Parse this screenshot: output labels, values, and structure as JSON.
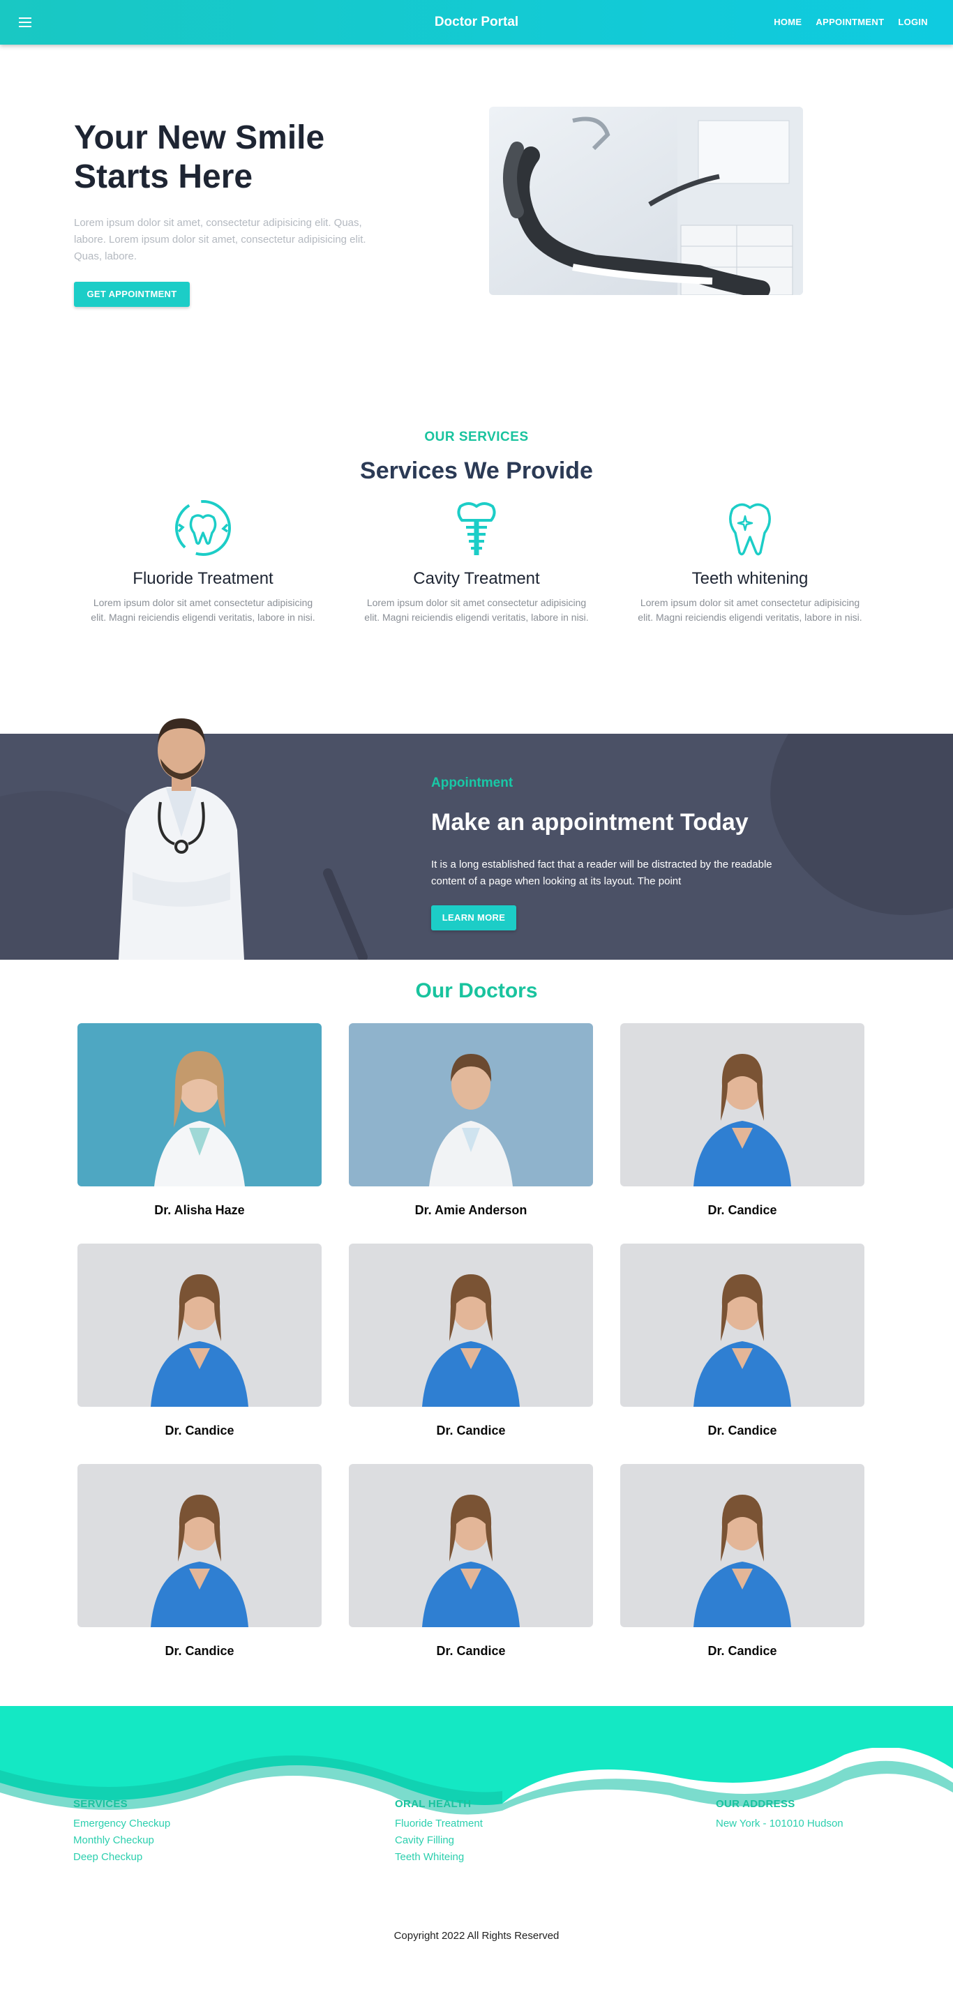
{
  "header": {
    "brand": "Doctor Portal",
    "nav": [
      "HOME",
      "APPOINTMENT",
      "LOGIN"
    ]
  },
  "hero": {
    "title": "Your New Smile Starts Here",
    "text": "Lorem ipsum dolor sit amet, consectetur adipisicing elit. Quas, labore. Lorem ipsum dolor sit amet, consectetur adipisicing elit. Quas, labore.",
    "button": "GET APPOINTMENT"
  },
  "services": {
    "eyebrow": "OUR SERVICES",
    "heading": "Services We Provide",
    "items": [
      {
        "icon": "tooth-cycle-icon",
        "title": "Fluoride Treatment",
        "desc": "Lorem ipsum dolor sit amet consectetur adipisicing elit. Magni reiciendis eligendi veritatis, labore in nisi."
      },
      {
        "icon": "dental-implant-icon",
        "title": "Cavity Treatment",
        "desc": "Lorem ipsum dolor sit amet consectetur adipisicing elit. Magni reiciendis eligendi veritatis, labore in nisi."
      },
      {
        "icon": "sparkling-tooth-icon",
        "title": "Teeth whitening",
        "desc": "Lorem ipsum dolor sit amet consectetur adipisicing elit. Magni reiciendis eligendi veritatis, labore in nisi."
      }
    ]
  },
  "appointment": {
    "eyebrow": "Appointment",
    "title": "Make an appointment Today",
    "text": "It is a long established fact that a reader will be distracted by the readable content of a page when looking at its layout. The point",
    "button": "LEARN MORE"
  },
  "doctors": {
    "heading": "Our Doctors",
    "items": [
      {
        "name": "Dr. Alisha Haze"
      },
      {
        "name": "Dr. Amie Anderson"
      },
      {
        "name": "Dr. Candice"
      },
      {
        "name": "Dr. Candice"
      },
      {
        "name": "Dr. Candice"
      },
      {
        "name": "Dr. Candice"
      },
      {
        "name": "Dr. Candice"
      },
      {
        "name": "Dr. Candice"
      },
      {
        "name": "Dr. Candice"
      }
    ]
  },
  "footer": {
    "columns": [
      {
        "heading": "SERVICES",
        "links": [
          "Emergency Checkup",
          "Monthly Checkup",
          "Deep Checkup"
        ]
      },
      {
        "heading": "ORAL HEALTH",
        "links": [
          "Fluoride Treatment",
          "Cavity Filling",
          "Teeth Whiteing"
        ]
      },
      {
        "heading": "OUR ADDRESS",
        "links": [
          "New York - 101010 Hudson"
        ]
      }
    ],
    "copyright": "Copyright 2022 All Rights Reserved"
  },
  "colors": {
    "accent": "#1ccdc7",
    "accent_green": "#19c39e",
    "band": "#4b5166",
    "heading": "#2b3a55"
  }
}
